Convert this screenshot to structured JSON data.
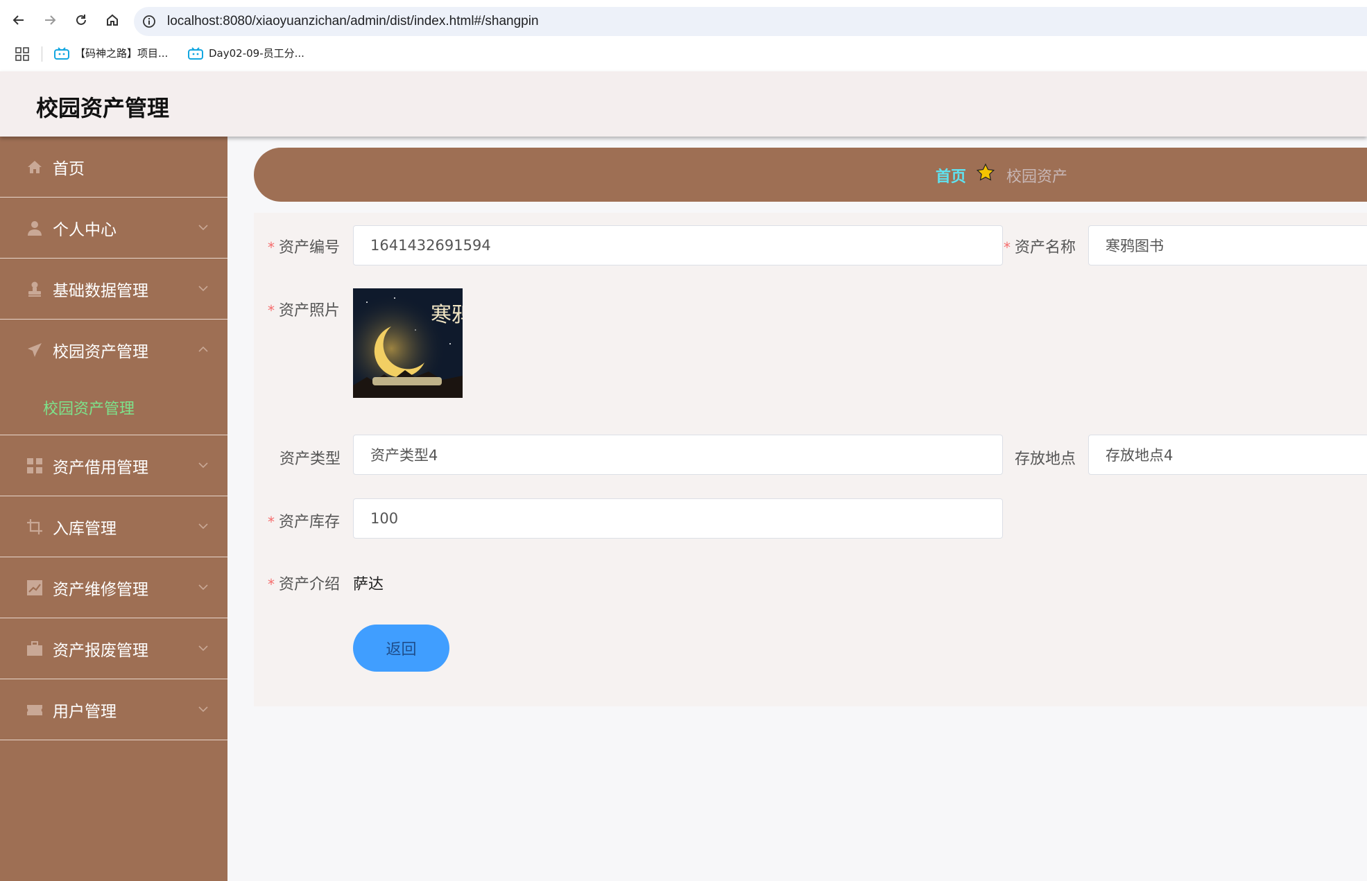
{
  "browser": {
    "url": "localhost:8080/xiaoyuanzichan/admin/dist/index.html#/shangpin",
    "bookmarks": [
      {
        "label": "【码神之路】项目..."
      },
      {
        "label": "Day02-09-员工分..."
      }
    ]
  },
  "header": {
    "title": "校园资产管理"
  },
  "sidebar": {
    "items": [
      {
        "label": "首页",
        "icon": "home-icon"
      },
      {
        "label": "个人中心",
        "icon": "user-icon"
      },
      {
        "label": "基础数据管理",
        "icon": "person-stamp-icon"
      },
      {
        "label": "校园资产管理",
        "icon": "paper-plane-icon",
        "expanded": true,
        "children": [
          {
            "label": "校园资产管理"
          }
        ]
      },
      {
        "label": "资产借用管理",
        "icon": "grid-icon"
      },
      {
        "label": "入库管理",
        "icon": "crop-icon"
      },
      {
        "label": "资产维修管理",
        "icon": "chart-icon"
      },
      {
        "label": "资产报废管理",
        "icon": "briefcase-icon"
      },
      {
        "label": "用户管理",
        "icon": "ticket-icon"
      }
    ]
  },
  "breadcrumb": {
    "home": "首页",
    "current": "校园资产"
  },
  "form": {
    "asset_no": {
      "label": "资产编号",
      "value": "1641432691594",
      "required": true
    },
    "asset_name": {
      "label": "资产名称",
      "value": "寒鸦图书",
      "required": true
    },
    "asset_photo": {
      "label": "资产照片",
      "required": true,
      "image_text": "寒鸦"
    },
    "asset_type": {
      "label": "资产类型",
      "value": "资产类型4"
    },
    "location": {
      "label": "存放地点",
      "value": "存放地点4"
    },
    "stock": {
      "label": "资产库存",
      "value": "100",
      "required": true
    },
    "intro": {
      "label": "资产介绍",
      "value": "萨达",
      "required": true
    },
    "back_button": "返回"
  },
  "colors": {
    "sidebar_bg": "#9e6f54",
    "active_submenu": "#7de38b",
    "breadcrumb_home": "#5fe2f0",
    "primary_button": "#409eff",
    "required_mark": "#f56c6c"
  }
}
